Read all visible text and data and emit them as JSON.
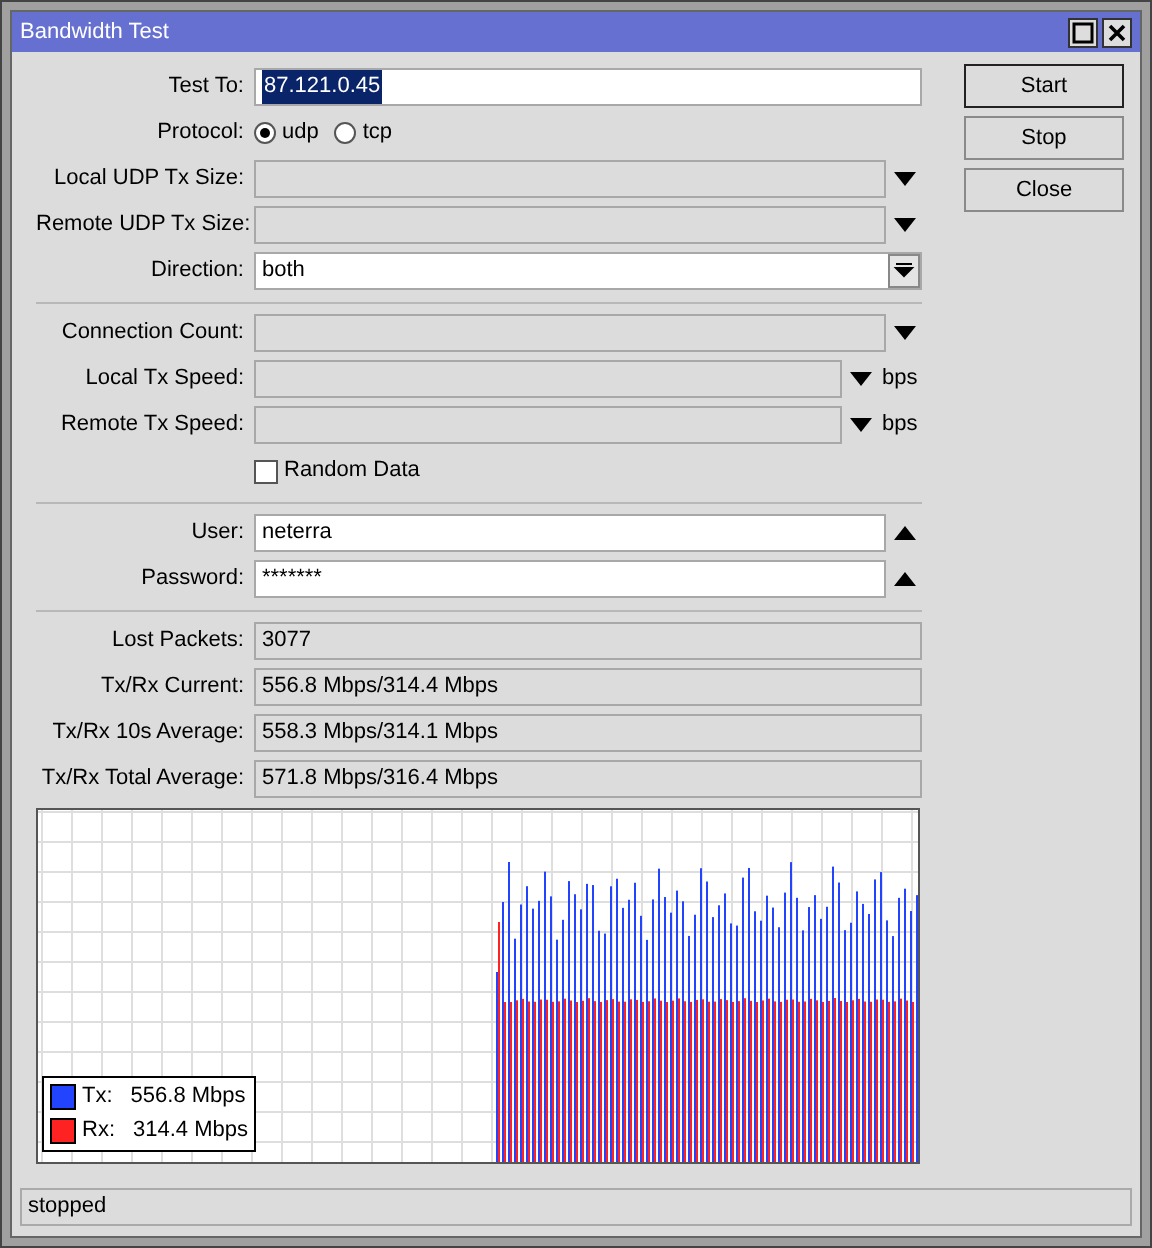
{
  "window": {
    "title": "Bandwidth Test"
  },
  "sections": [
    [
      {
        "kind": "text",
        "label": "Test To:",
        "value": "87.121.0.45",
        "highlighted": true
      },
      {
        "kind": "radio",
        "label": "Protocol:",
        "options": [
          {
            "label": "udp",
            "selected": true
          },
          {
            "label": "tcp",
            "selected": false
          }
        ]
      },
      {
        "kind": "unset",
        "label": "Local UDP Tx Size:"
      },
      {
        "kind": "unset",
        "label": "Remote UDP Tx Size:"
      },
      {
        "kind": "select",
        "label": "Direction:",
        "value": "both"
      }
    ],
    [
      {
        "kind": "unset",
        "label": "Connection Count:"
      },
      {
        "kind": "unset",
        "label": "Local Tx Speed:",
        "unit": "bps"
      },
      {
        "kind": "unset",
        "label": "Remote Tx Speed:",
        "unit": "bps"
      },
      {
        "kind": "checkbox",
        "label": "Random Data",
        "checked": false
      }
    ],
    [
      {
        "kind": "set",
        "label": "User:",
        "value": "neterra"
      },
      {
        "kind": "set",
        "label": "Password:",
        "value": "*******"
      }
    ],
    [
      {
        "kind": "readonly",
        "label": "Lost Packets:",
        "value": "3077"
      },
      {
        "kind": "readonly",
        "label": "Tx/Rx Current:",
        "value": "556.8 Mbps/314.4 Mbps"
      },
      {
        "kind": "readonly",
        "label": "Tx/Rx 10s Average:",
        "value": "558.3 Mbps/314.1 Mbps"
      },
      {
        "kind": "readonly",
        "label": "Tx/Rx Total Average:",
        "value": "571.8 Mbps/316.4 Mbps"
      }
    ]
  ],
  "buttons": [
    {
      "label": "Start",
      "focused": true
    },
    {
      "label": "Stop",
      "focused": false
    },
    {
      "label": "Close",
      "focused": false
    }
  ],
  "graph": {
    "legend": [
      {
        "label": "Tx:",
        "value": "556.8 Mbps",
        "color": "#2244ff"
      },
      {
        "label": "Rx:",
        "value": "314.4 Mbps",
        "color": "#ff2222"
      }
    ]
  },
  "status_bar": "stopped"
}
